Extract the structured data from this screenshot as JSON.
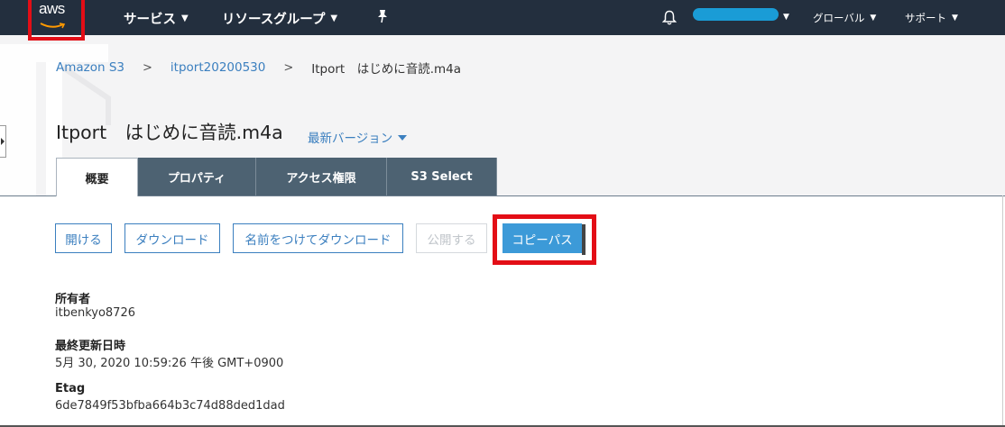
{
  "nav": {
    "logo": "aws",
    "services": "サービス",
    "resource_groups": "リソースグループ",
    "region": "グローバル",
    "support": "サポート"
  },
  "breadcrumb": {
    "root": "Amazon S3",
    "bucket": "itport20200530",
    "object": "Itport　はじめに音読.m4a"
  },
  "title": "Itport　はじめに音読.m4a",
  "version_label": "最新バージョン",
  "tabs": [
    {
      "label": "概要"
    },
    {
      "label": "プロパティ"
    },
    {
      "label": "アクセス権限"
    },
    {
      "label": "S3 Select"
    }
  ],
  "actions": {
    "open": "開ける",
    "download": "ダウンロード",
    "download_as": "名前をつけてダウンロード",
    "publish": "公開する",
    "copy_path": "コピーパス"
  },
  "properties": {
    "owner_label": "所有者",
    "owner_value": "itbenkyo8726",
    "modified_label": "最終更新日時",
    "modified_value": "5月 30, 2020 10:59:26 午後 GMT+0900",
    "etag_label": "Etag",
    "etag_value": "6de7849f53bfba664b3c74d88ded1dad"
  },
  "colors": {
    "nav_bg": "#232f3e",
    "link": "#3b7fbf",
    "primary": "#3c9ad8",
    "highlight": "#e30e16",
    "tab_inactive": "#4d6272"
  }
}
